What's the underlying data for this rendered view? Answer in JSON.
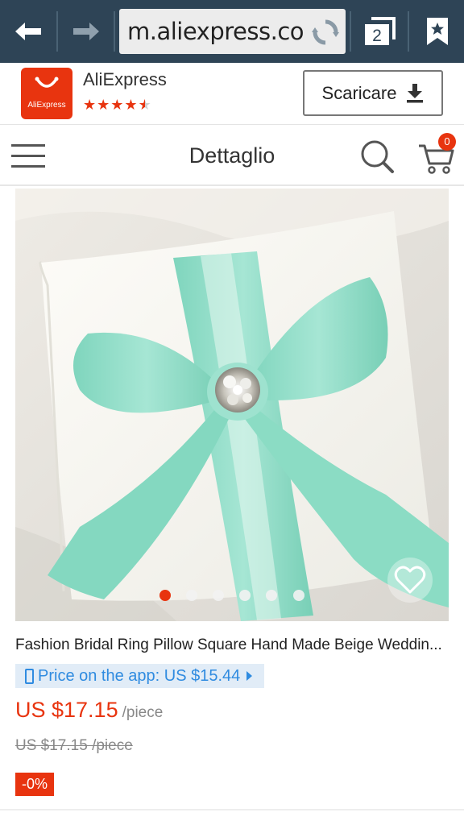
{
  "browser": {
    "url": "m.aliexpress.com",
    "tab_count": "2",
    "icons": {
      "back": "back-arrow-icon",
      "forward": "forward-arrow-icon",
      "reload": "reload-icon",
      "tabs": "tabs-icon",
      "bookmark": "bookmark-star-icon"
    },
    "colors": {
      "toolbar": "#2e4456",
      "url_bg": "#ececec"
    }
  },
  "app_banner": {
    "logo_text": "AliExpress",
    "app_name": "AliExpress",
    "rating": 4.5,
    "rating_max": 5,
    "download_label": "Scaricare"
  },
  "header": {
    "title": "Dettaglio",
    "cart_count": "0"
  },
  "product": {
    "image_count": 6,
    "active_image": 1,
    "title": "Fashion Bridal Ring Pillow Square Hand Made Beige Weddin...",
    "app_price_label": "Price on the app: US $15.44",
    "price": "US $17.15",
    "price_unit": "/piece",
    "original_price": "US $17.15 /piece",
    "discount": "-0%"
  },
  "colors": {
    "accent": "#e8340f",
    "app_price_blue": "#2f8be0",
    "app_price_bg": "#e1ecf7",
    "ribbon": "#8fdcc6"
  }
}
